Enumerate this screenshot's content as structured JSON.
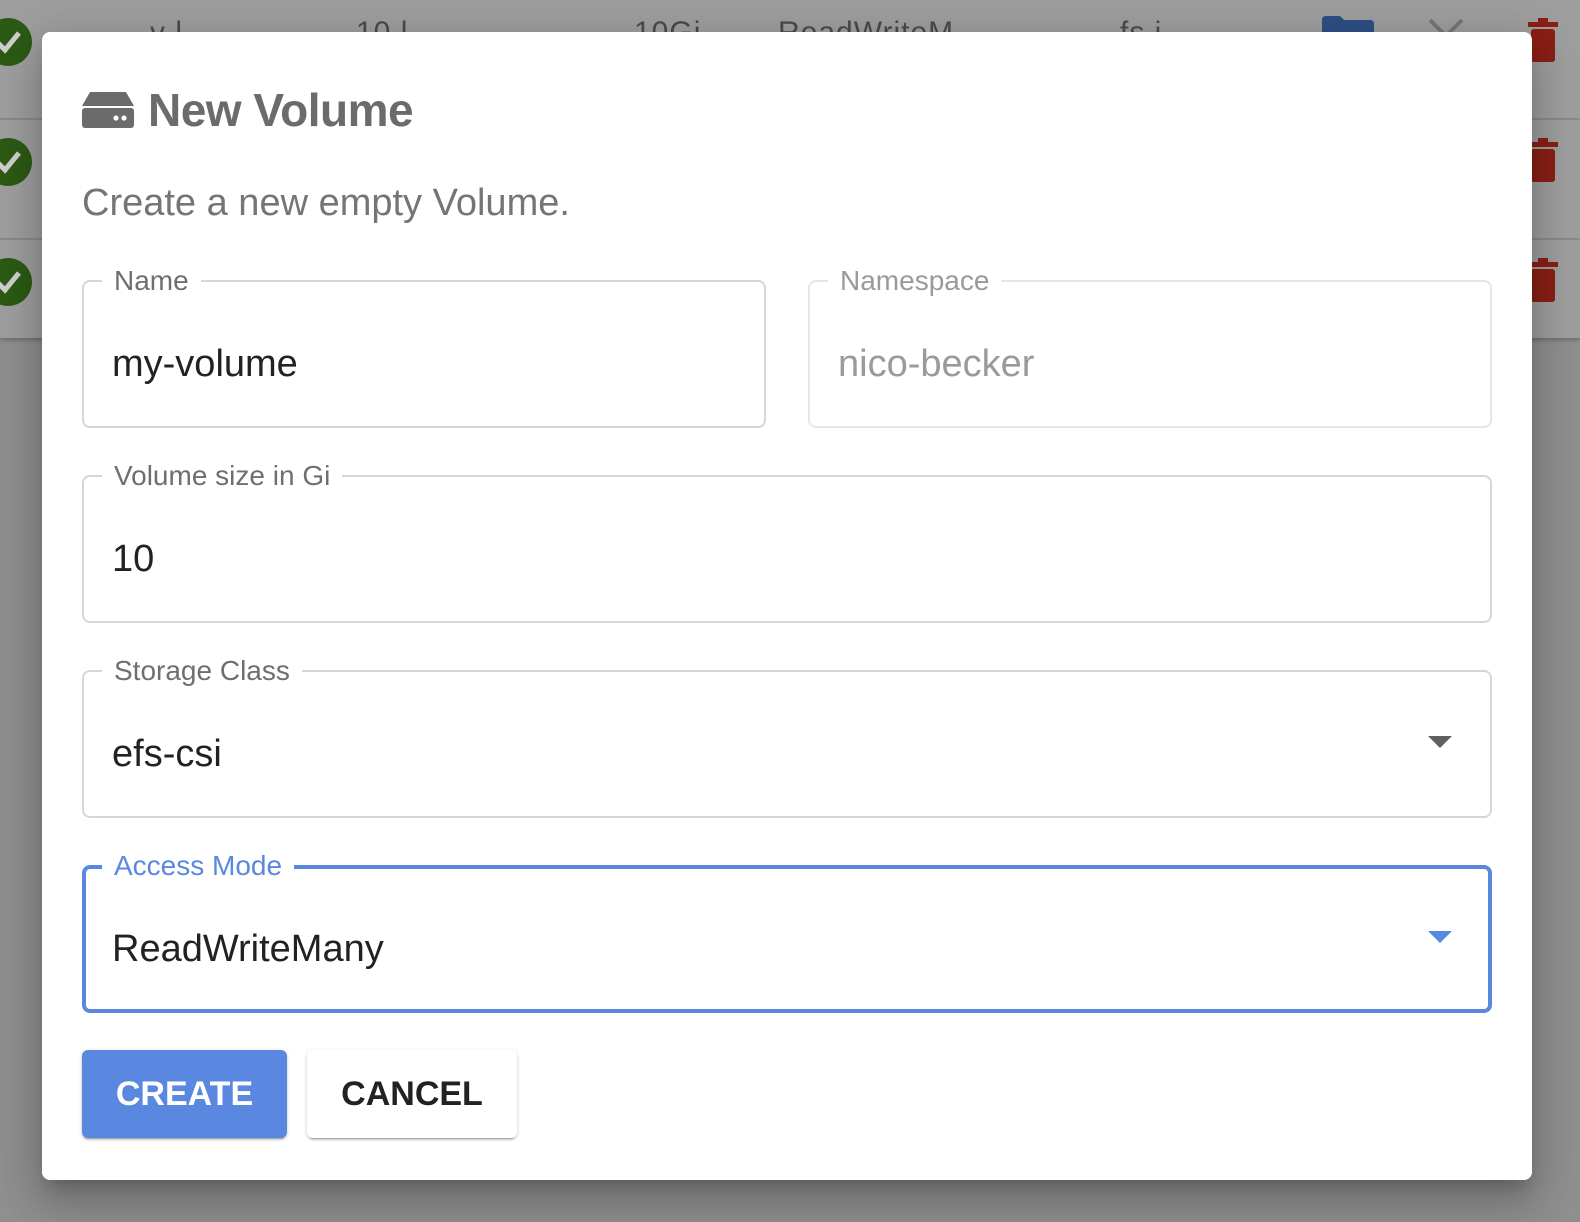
{
  "background": {
    "rows": [
      {
        "text_fragments": [
          "v    l",
          "10 l",
          "10Gi",
          "ReadWriteM",
          "fs  i"
        ]
      },
      {
        "text_fragments": []
      },
      {
        "text_fragments": []
      }
    ],
    "colors": {
      "status_ok": "#2c5a14",
      "delete": "#8a1f14",
      "folder": "#2e4f85"
    }
  },
  "dialog": {
    "title": "New Volume",
    "title_icon": "hard-drive-icon",
    "subtitle": "Create a new empty Volume.",
    "fields": {
      "name": {
        "label": "Name",
        "value": "my-volume"
      },
      "namespace": {
        "label": "Namespace",
        "value": "nico-becker",
        "disabled": true
      },
      "volume_size": {
        "label": "Volume size in Gi",
        "value": "10"
      },
      "storage_class": {
        "label": "Storage Class",
        "value": "efs-csi"
      },
      "access_mode": {
        "label": "Access Mode",
        "value": "ReadWriteMany",
        "focused": true
      }
    },
    "buttons": {
      "create": "CREATE",
      "cancel": "CANCEL"
    },
    "colors": {
      "accent": "#5a88e0",
      "title": "#6b6b6b"
    }
  }
}
